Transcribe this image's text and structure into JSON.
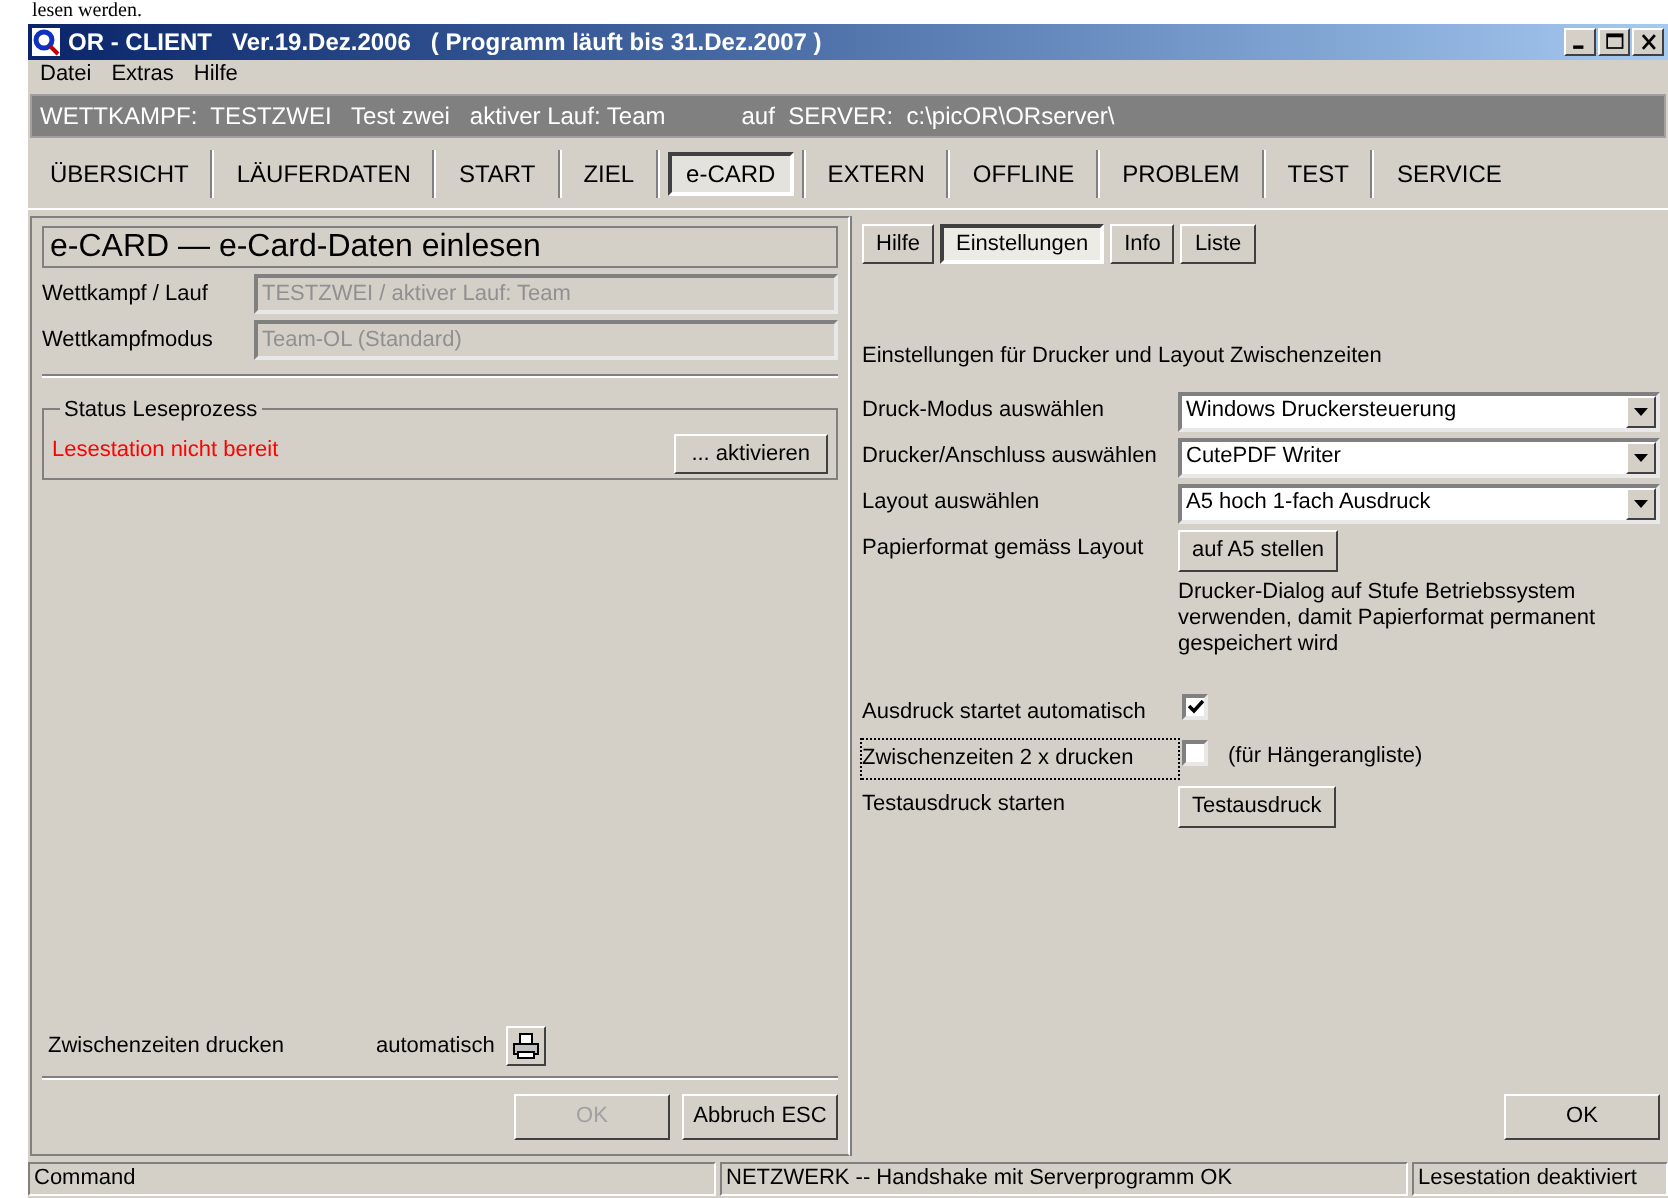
{
  "doc_fragment": "lesen werden.",
  "window": {
    "title": "OR - CLIENT   Ver.19.Dez.2006   ( Programm läuft bis 31.Dez.2007 )"
  },
  "menu": [
    "Datei",
    "Extras",
    "Hilfe"
  ],
  "info_bar": [
    "WETTKAMPF:  TESTZWEI   Test zwei   aktiver Lauf: Team",
    "auf  SERVER:  c:\\picOR\\ORserver\\"
  ],
  "main_tabs": [
    {
      "label": "ÜBERSICHT",
      "selected": false
    },
    {
      "label": "LÄUFERDATEN",
      "selected": false
    },
    {
      "label": "START",
      "selected": false
    },
    {
      "label": "ZIEL",
      "selected": false
    },
    {
      "label": "e-CARD",
      "selected": true
    },
    {
      "label": "EXTERN",
      "selected": false
    },
    {
      "label": "OFFLINE",
      "selected": false
    },
    {
      "label": "PROBLEM",
      "selected": false
    },
    {
      "label": "TEST",
      "selected": false
    },
    {
      "label": "SERVICE",
      "selected": false
    }
  ],
  "left_panel": {
    "heading": "e-CARD — e-Card-Daten einlesen",
    "fields": [
      {
        "label": "Wettkampf / Lauf",
        "value": "TESTZWEI / aktiver Lauf: Team"
      },
      {
        "label": "Wettkampfmodus",
        "value": "Team-OL (Standard)"
      }
    ],
    "status_group": {
      "title": "Status Leseprozess",
      "message": "Lesestation nicht bereit",
      "button": "... aktivieren"
    },
    "print_row": {
      "label": "Zwischenzeiten drucken",
      "mode": "automatisch"
    },
    "buttons": [
      {
        "label": "OK",
        "disabled": true
      },
      {
        "label": "Abbruch ESC",
        "disabled": false
      }
    ]
  },
  "right_panel": {
    "tabs": [
      {
        "label": "Hilfe",
        "selected": false
      },
      {
        "label": "Einstellungen",
        "selected": true
      },
      {
        "label": "Info",
        "selected": false
      },
      {
        "label": "Liste",
        "selected": false
      }
    ],
    "description": "Einstellungen für Drucker und Layout Zwischenzeiten",
    "settings": [
      {
        "kind": "select",
        "label": "Druck-Modus auswählen",
        "value": "Windows Druckersteuerung"
      },
      {
        "kind": "select",
        "label": "Drucker/Anschluss auswählen",
        "value": "CutePDF Writer"
      },
      {
        "kind": "select",
        "label": "Layout auswählen",
        "value": "A5 hoch  1-fach Ausdruck"
      },
      {
        "kind": "button",
        "label": "Papierformat gemäss Layout",
        "button": "auf A5 stellen",
        "note": "Drucker-Dialog auf Stufe Betriebssystem verwenden, damit Papierformat permanent gespeichert wird"
      },
      {
        "kind": "checkbox",
        "label": "Ausdruck startet automatisch",
        "checked": true,
        "focused": false
      },
      {
        "kind": "checkbox",
        "label": "Zwischenzeiten 2 x drucken",
        "checked": false,
        "focused": true,
        "note": "(für Hängerangliste)"
      },
      {
        "kind": "button",
        "label": "Testausdruck starten",
        "button": "Testausdruck"
      }
    ],
    "ok_button": "OK"
  },
  "status_bar": [
    "Command",
    "NETZWERK -- Handshake mit Serverprogramm OK",
    "Lesestation deaktiviert"
  ]
}
